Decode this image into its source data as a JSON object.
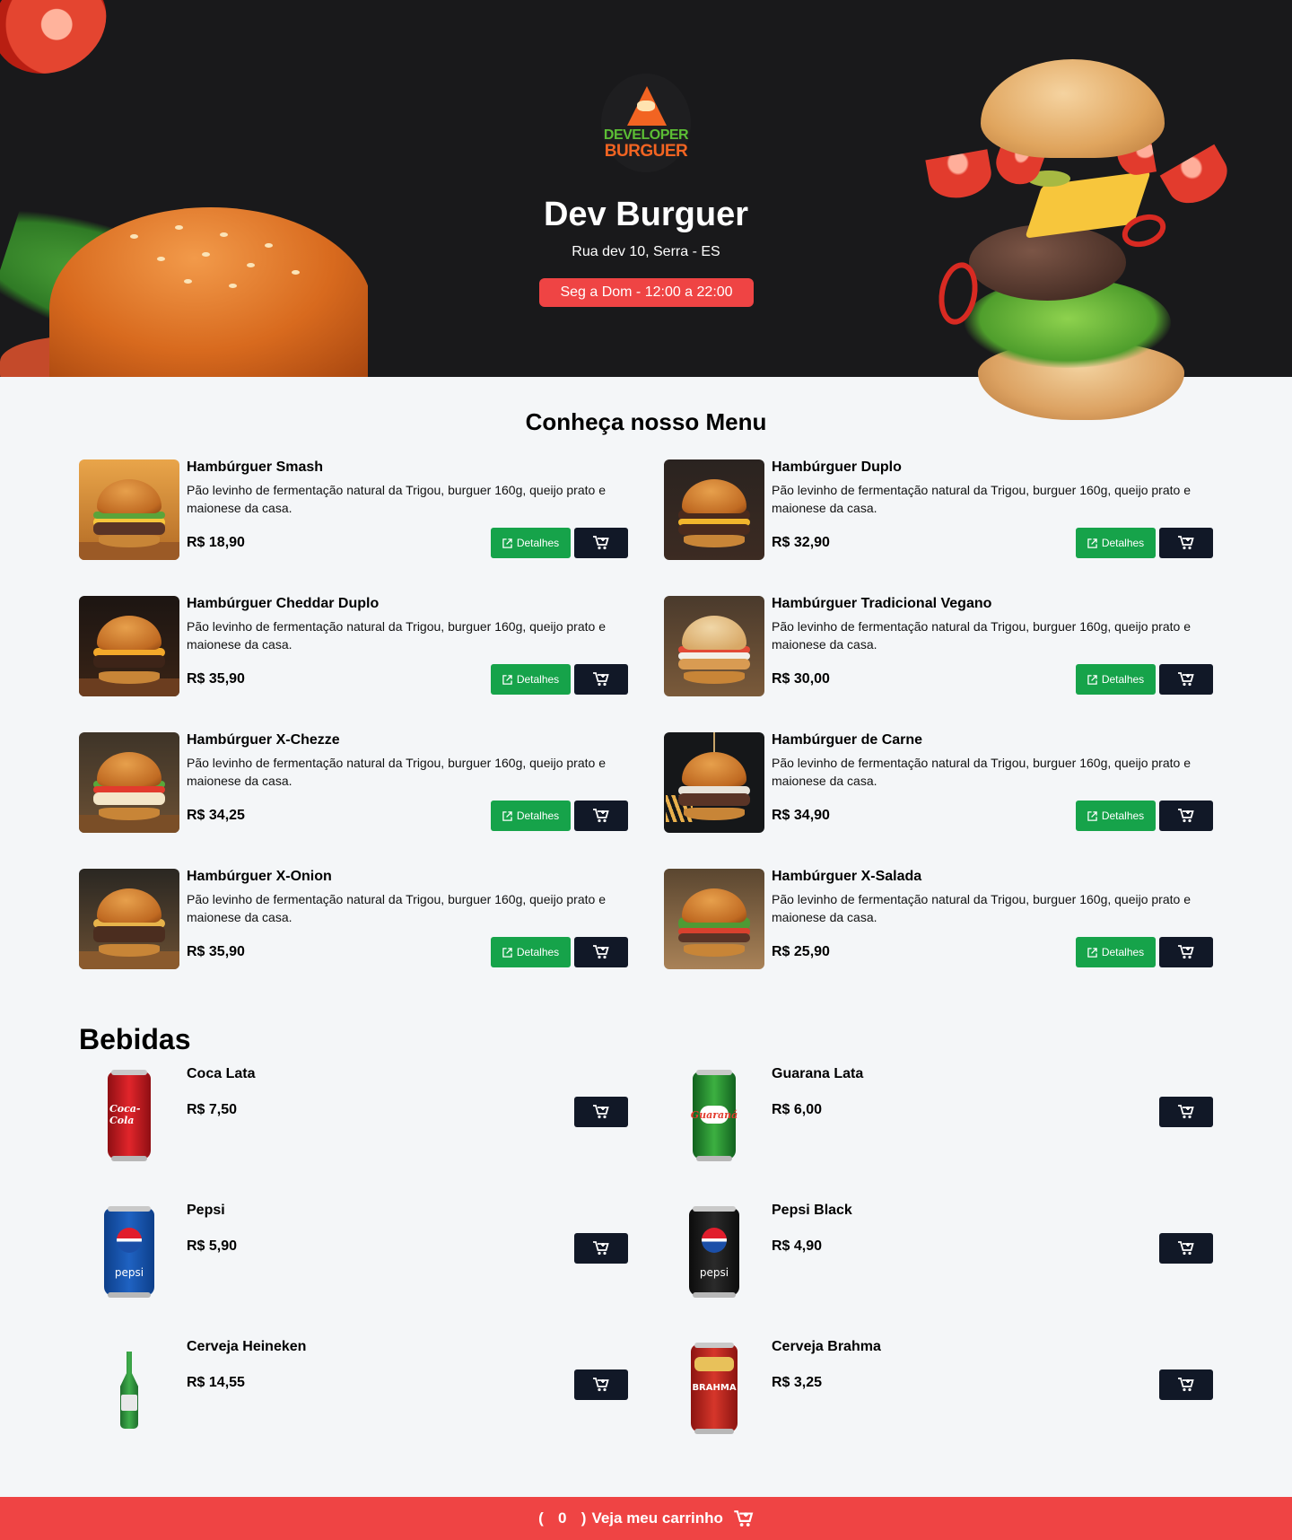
{
  "header": {
    "logo_line1": "DEVELOPER",
    "logo_line2": "BURGUER",
    "title": "Dev Burguer",
    "address": "Rua dev 10, Serra - ES",
    "hours": "Seg a Dom - 12:00 a 22:00"
  },
  "menu": {
    "title": "Conheça nosso Menu",
    "details_label": "Detalhes",
    "items": [
      {
        "name": "Hambúrguer Smash",
        "description": "Pão levinho de fermentação natural da Trigou, burguer 160g, queijo prato e maionese da casa.",
        "price": "R$ 18,90"
      },
      {
        "name": "Hambúrguer Duplo",
        "description": "Pão levinho de fermentação natural da Trigou, burguer 160g, queijo prato e maionese da casa.",
        "price": "R$ 32,90"
      },
      {
        "name": "Hambúrguer Cheddar Duplo",
        "description": "Pão levinho de fermentação natural da Trigou, burguer 160g, queijo prato e maionese da casa.",
        "price": "R$ 35,90"
      },
      {
        "name": "Hambúrguer Tradicional Vegano",
        "description": "Pão levinho de fermentação natural da Trigou, burguer 160g, queijo prato e maionese da casa.",
        "price": "R$ 30,00"
      },
      {
        "name": "Hambúrguer X-Chezze",
        "description": "Pão levinho de fermentação natural da Trigou, burguer 160g, queijo prato e maionese da casa.",
        "price": "R$ 34,25"
      },
      {
        "name": "Hambúrguer de Carne",
        "description": "Pão levinho de fermentação natural da Trigou, burguer 160g, queijo prato e maionese da casa.",
        "price": "R$ 34,90"
      },
      {
        "name": "Hambúrguer X-Onion",
        "description": "Pão levinho de fermentação natural da Trigou, burguer 160g, queijo prato e maionese da casa.",
        "price": "R$ 35,90"
      },
      {
        "name": "Hambúrguer X-Salada",
        "description": "Pão levinho de fermentação natural da Trigou, burguer 160g, queijo prato e maionese da casa.",
        "price": "R$ 25,90"
      }
    ]
  },
  "drinks": {
    "title": "Bebidas",
    "items": [
      {
        "name": "Coca Lata",
        "price": "R$ 7,50",
        "can_label": "Coca-Cola"
      },
      {
        "name": "Guarana Lata",
        "price": "R$ 6,00",
        "can_label": "Guaraná"
      },
      {
        "name": "Pepsi",
        "price": "R$ 5,90",
        "can_label": "pepsi"
      },
      {
        "name": "Pepsi Black",
        "price": "R$ 4,90",
        "can_label": "pepsi"
      },
      {
        "name": "Cerveja Heineken",
        "price": "R$ 14,55",
        "can_label": ""
      },
      {
        "name": "Cerveja Brahma",
        "price": "R$ 3,25",
        "can_label": "BRAHMA"
      }
    ]
  },
  "cart": {
    "open_paren": "(",
    "count": "0",
    "close_paren": ")",
    "label": "Veja meu carrinho"
  },
  "colors": {
    "hero_bg": "#19191b",
    "accent_red": "#ef4444",
    "details_green": "#16a34a",
    "cart_button": "#111827",
    "page_bg": "#f4f6f8"
  },
  "icons": {
    "details": "external-link-icon",
    "add_to_cart": "cart-plus-icon",
    "footer_cart": "cart-plus-icon"
  }
}
